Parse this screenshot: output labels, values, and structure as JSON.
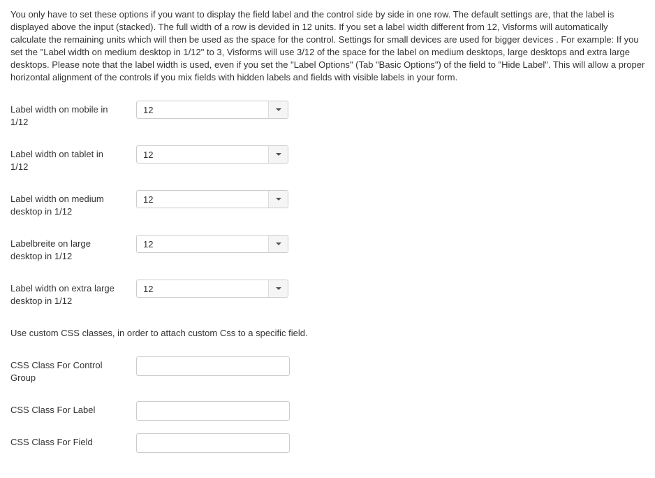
{
  "intro_text": "You only have to set these options if you want to display the field label and the control side by side in one row. The default settings are, that the label is displayed above the input (stacked). The full width of a row is devided in 12 units. If you set a label width different from 12, Visforms will automatically calculate the remaining units which will then be used as the space for the control. Settings for small devices are used for bigger devices . For example: If you set the \"Label width on medium desktop in 1/12\" to 3, Visforms will use 3/12 of the space for the label on medium desktops, large desktops and extra large desktops. Please note that the label width is used, even if you set the \"Label Options\" (Tab \"Basic Options\") of the field to \"Hide Label\". This will allow a proper horizontal alignment of the controls if you mix fields with hidden labels and fields with visible labels in your form.",
  "label_widths": [
    {
      "label": "Label width on mobile in 1/12",
      "value": "12"
    },
    {
      "label": "Label width on tablet in 1/12",
      "value": "12"
    },
    {
      "label": "Label width on medium desktop in 1/12",
      "value": "12"
    },
    {
      "label": "Labelbreite on large desktop in 1/12",
      "value": "12"
    },
    {
      "label": "Label width on extra large desktop in 1/12",
      "value": "12"
    }
  ],
  "css_note": "Use custom CSS classes, in order to attach custom Css to a specific field.",
  "css_fields": [
    {
      "label": "CSS Class For Control Group",
      "value": ""
    },
    {
      "label": "CSS Class For Label",
      "value": ""
    },
    {
      "label": "CSS Class For Field",
      "value": ""
    }
  ]
}
